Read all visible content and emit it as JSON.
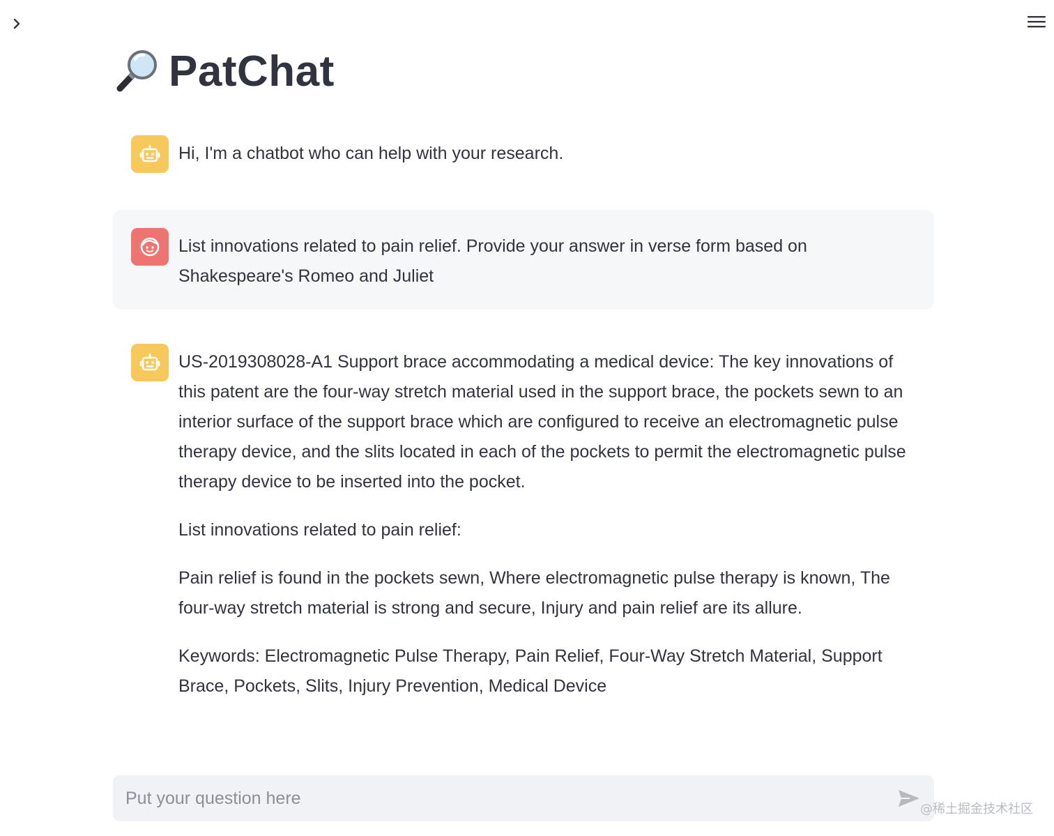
{
  "header": {
    "sidebar_toggle_icon": "chevron-right-icon",
    "menu_icon": "hamburger-menu-icon"
  },
  "title": {
    "icon": "magnifying-glass-icon",
    "text": "PatChat"
  },
  "messages": [
    {
      "role": "assistant",
      "avatar_icon": "robot-icon",
      "paragraphs": [
        "Hi, I'm a chatbot who can help with your research."
      ]
    },
    {
      "role": "user",
      "avatar_icon": "smiley-face-icon",
      "paragraphs": [
        "List innovations related to pain relief. Provide your answer in verse form based on Shakespeare's Romeo and Juliet"
      ]
    },
    {
      "role": "assistant",
      "avatar_icon": "robot-icon",
      "paragraphs": [
        "US-2019308028-A1 Support brace accommodating a medical device: The key innovations of this patent are the four-way stretch material used in the support brace, the pockets sewn to an interior surface of the support brace which are configured to receive an electromagnetic pulse therapy device, and the slits located in each of the pockets to permit the electromagnetic pulse therapy device to be inserted into the pocket.",
        "List innovations related to pain relief:",
        "Pain relief is found in the pockets sewn, Where electromagnetic pulse therapy is known, The four-way stretch material is strong and secure, Injury and pain relief are its allure.",
        "Keywords: Electromagnetic Pulse Therapy, Pain Relief, Four-Way Stretch Material, Support Brace, Pockets, Slits, Injury Prevention, Medical Device"
      ]
    }
  ],
  "chat_input": {
    "placeholder": "Put your question here",
    "value": "",
    "send_icon": "send-arrow-icon"
  },
  "watermark": "@稀土掘金技术社区",
  "colors": {
    "bot_avatar": "#f7c95c",
    "user_avatar": "#ee7470",
    "user_message_bg": "#f6f7f9",
    "input_bg": "#f0f2f6",
    "text": "#31333f"
  }
}
